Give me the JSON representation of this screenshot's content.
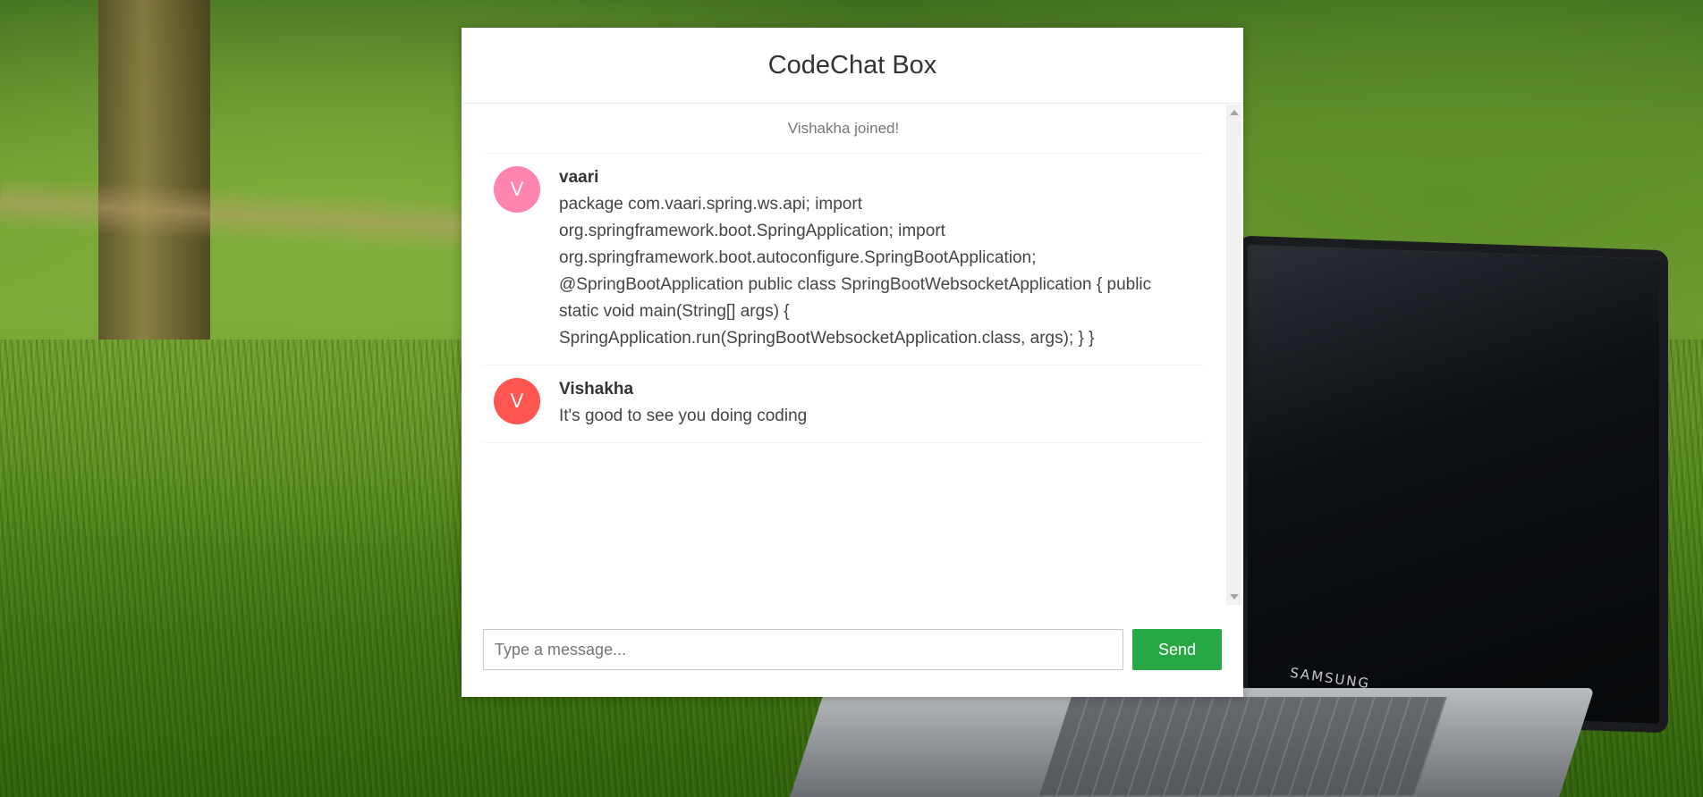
{
  "app": {
    "title": "CodeChat Box"
  },
  "messages": {
    "event": "Vishakha joined!",
    "items": [
      {
        "avatar_letter": "V",
        "avatar_color": "#ff85af",
        "sender": "vaari",
        "text": "package com.vaari.spring.ws.api; import org.springframework.boot.SpringApplication; import org.springframework.boot.autoconfigure.SpringBootApplication; @SpringBootApplication public class SpringBootWebsocketApplication { public static void main(String[] args) { SpringApplication.run(SpringBootWebsocketApplication.class, args); } }"
      },
      {
        "avatar_letter": "V",
        "avatar_color": "#ff5652",
        "sender": "Vishakha",
        "text": "It's good to see you doing coding"
      }
    ]
  },
  "composer": {
    "input_value": "",
    "input_placeholder": "Type a message...",
    "send_label": "Send",
    "send_color": "#28a745"
  },
  "background": {
    "laptop_brand": "SAMSUNG"
  }
}
